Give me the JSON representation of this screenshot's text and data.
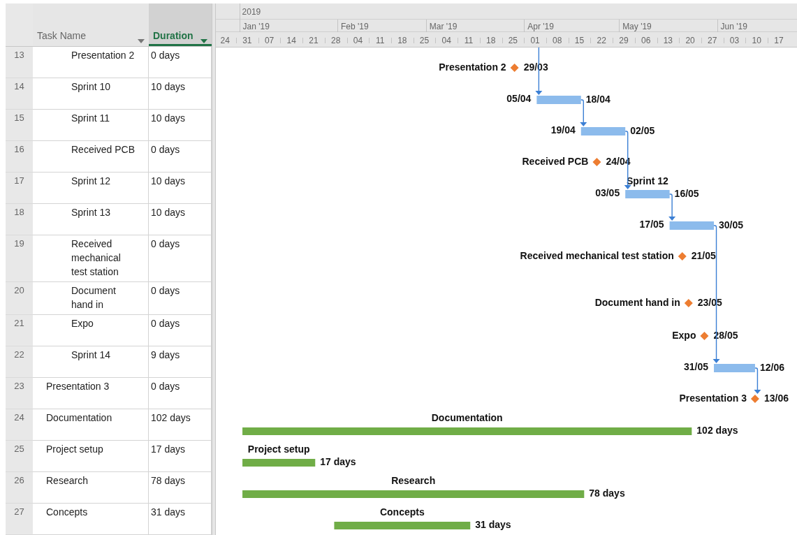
{
  "columns": [
    {
      "label": "Task Name",
      "selected": false
    },
    {
      "label": "Duration",
      "selected": true
    }
  ],
  "timescale": {
    "year": "2019",
    "months": [
      "Jan '19",
      "Feb '19",
      "Mar '19",
      "Apr '19",
      "May '19",
      "Jun '19"
    ],
    "weeks": [
      "24",
      "31",
      "07",
      "14",
      "21",
      "28",
      "04",
      "11",
      "18",
      "25",
      "04",
      "11",
      "18",
      "25",
      "01",
      "08",
      "15",
      "22",
      "29",
      "06",
      "13",
      "20",
      "27",
      "03",
      "10",
      "17"
    ]
  },
  "tasks": [
    {
      "children": [
        {
          "children": [
            {
              "id": "13",
              "name": "Presentation 2",
              "duration": "0 days",
              "bar": {
                "kind": "milestone",
                "left_label": "Presentation 2",
                "right_label": "29/03",
                "link_in": false
              }
            },
            {
              "id": "14",
              "name": "Sprint 10",
              "duration": "10 days",
              "bar": {
                "kind": "sprint",
                "left_label": "05/04",
                "right_label": "18/04",
                "link_in": true
              }
            },
            {
              "id": "15",
              "name": "Sprint 11",
              "duration": "10 days",
              "bar": {
                "kind": "sprint",
                "left_label": "19/04",
                "right_label": "02/05",
                "link_in": true
              }
            },
            {
              "id": "16",
              "name": "Received PCB",
              "duration": "0 days",
              "bar": {
                "kind": "milestone",
                "left_label": "Received PCB",
                "right_label": "24/04",
                "link_in": false
              }
            },
            {
              "id": "17",
              "name": "Sprint 12",
              "duration": "10 days",
              "bar": {
                "kind": "sprint",
                "top_label": "Sprint 12",
                "left_label": "03/05",
                "right_label": "16/05",
                "link_in": true
              }
            },
            {
              "id": "18",
              "name": "Sprint 13",
              "duration": "10 days",
              "bar": {
                "kind": "sprint",
                "left_label": "17/05",
                "right_label": "30/05",
                "link_in": true
              }
            },
            {
              "id": "19",
              "name": "Received mechanical test station",
              "duration": "0 days",
              "bar": {
                "kind": "milestone",
                "left_label": "Received mechanical test station",
                "right_label": "21/05",
                "link_in": false
              }
            },
            {
              "id": "20",
              "name": "Document hand in",
              "duration": "0 days",
              "bar": {
                "kind": "milestone",
                "left_label": "Document hand in",
                "right_label": "23/05",
                "link_in": false
              }
            },
            {
              "id": "21",
              "name": "Expo",
              "duration": "0 days",
              "bar": {
                "kind": "milestone",
                "left_label": "Expo",
                "right_label": "28/05",
                "link_in": false
              }
            },
            {
              "id": "22",
              "name": "Sprint 14",
              "duration": "9 days",
              "bar": {
                "kind": "sprint",
                "left_label": "31/05",
                "right_label": "12/06",
                "link_in": true
              }
            }
          ]
        }
      ]
    },
    {
      "id": "23",
      "name": "Presentation 3",
      "duration": "0 days",
      "bar": {
        "kind": "milestone",
        "left_label": "Presentation 3",
        "right_label": "13/06",
        "link_in": true
      }
    },
    {
      "id": "24",
      "name": "Documentation",
      "duration": "102 days",
      "bar": {
        "kind": "phase",
        "top_label": "Documentation",
        "right_label": "102 days"
      }
    },
    {
      "id": "25",
      "name": "Project setup",
      "duration": "17 days",
      "bar": {
        "kind": "phase",
        "top_label": "Project setup",
        "right_label": "17 days"
      }
    },
    {
      "id": "26",
      "name": "Research",
      "duration": "78 days",
      "bar": {
        "kind": "phase",
        "top_label": "Research",
        "right_label": "78 days"
      }
    },
    {
      "id": "27",
      "name": "Concepts",
      "duration": "31 days",
      "bar": {
        "kind": "phase",
        "top_label": "Concepts",
        "right_label": "31 days"
      }
    }
  ]
}
